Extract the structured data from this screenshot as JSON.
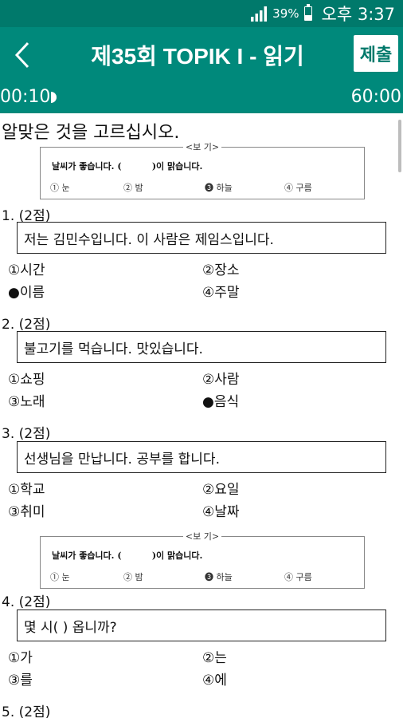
{
  "status": {
    "battery": "39%",
    "time": "오후 3:37",
    "battery_level": 0.39
  },
  "header": {
    "title": "제35회 TOPIK I - 읽기",
    "submit_label": "제출"
  },
  "timer": {
    "elapsed": "00:10",
    "total": "60:00"
  },
  "instruction": "알맞은 것을 고르십시오.",
  "examples": [
    {
      "label": "<보   기>",
      "sentence": "날씨가 좋습니다. (          )이 맑습니다.",
      "options": [
        "① 눈",
        "② 밤",
        "❸ 하늘",
        "④ 구름"
      ]
    },
    {
      "label": "<보   기>",
      "sentence": "날씨가 좋습니다. (          )이 맑습니다.",
      "options": [
        "① 눈",
        "② 밤",
        "❸ 하늘",
        "④ 구름"
      ]
    }
  ],
  "questions": [
    {
      "header": "1. (2점)",
      "text": "저는 김민수입니다. 이 사람은 제임스입니다.",
      "options": [
        "①시간",
        "②장소",
        "●이름",
        "④주말"
      ]
    },
    {
      "header": "2. (2점)",
      "text": "불고기를 먹습니다. 맛있습니다.",
      "options": [
        "①쇼핑",
        "②사람",
        "③노래",
        "●음식"
      ]
    },
    {
      "header": "3. (2점)",
      "text": "선생님을 만납니다. 공부를 합니다.",
      "options": [
        "①학교",
        "②요일",
        "③취미",
        "④날짜"
      ]
    },
    {
      "header": "4. (2점)",
      "text": "몇 시(     ) 옵니까?",
      "options": [
        "①가",
        "②는",
        "③를",
        "④에"
      ]
    },
    {
      "header": "5. (2점)"
    }
  ],
  "colors": {
    "statusbar": "#00796b",
    "appbar": "#00897b"
  }
}
